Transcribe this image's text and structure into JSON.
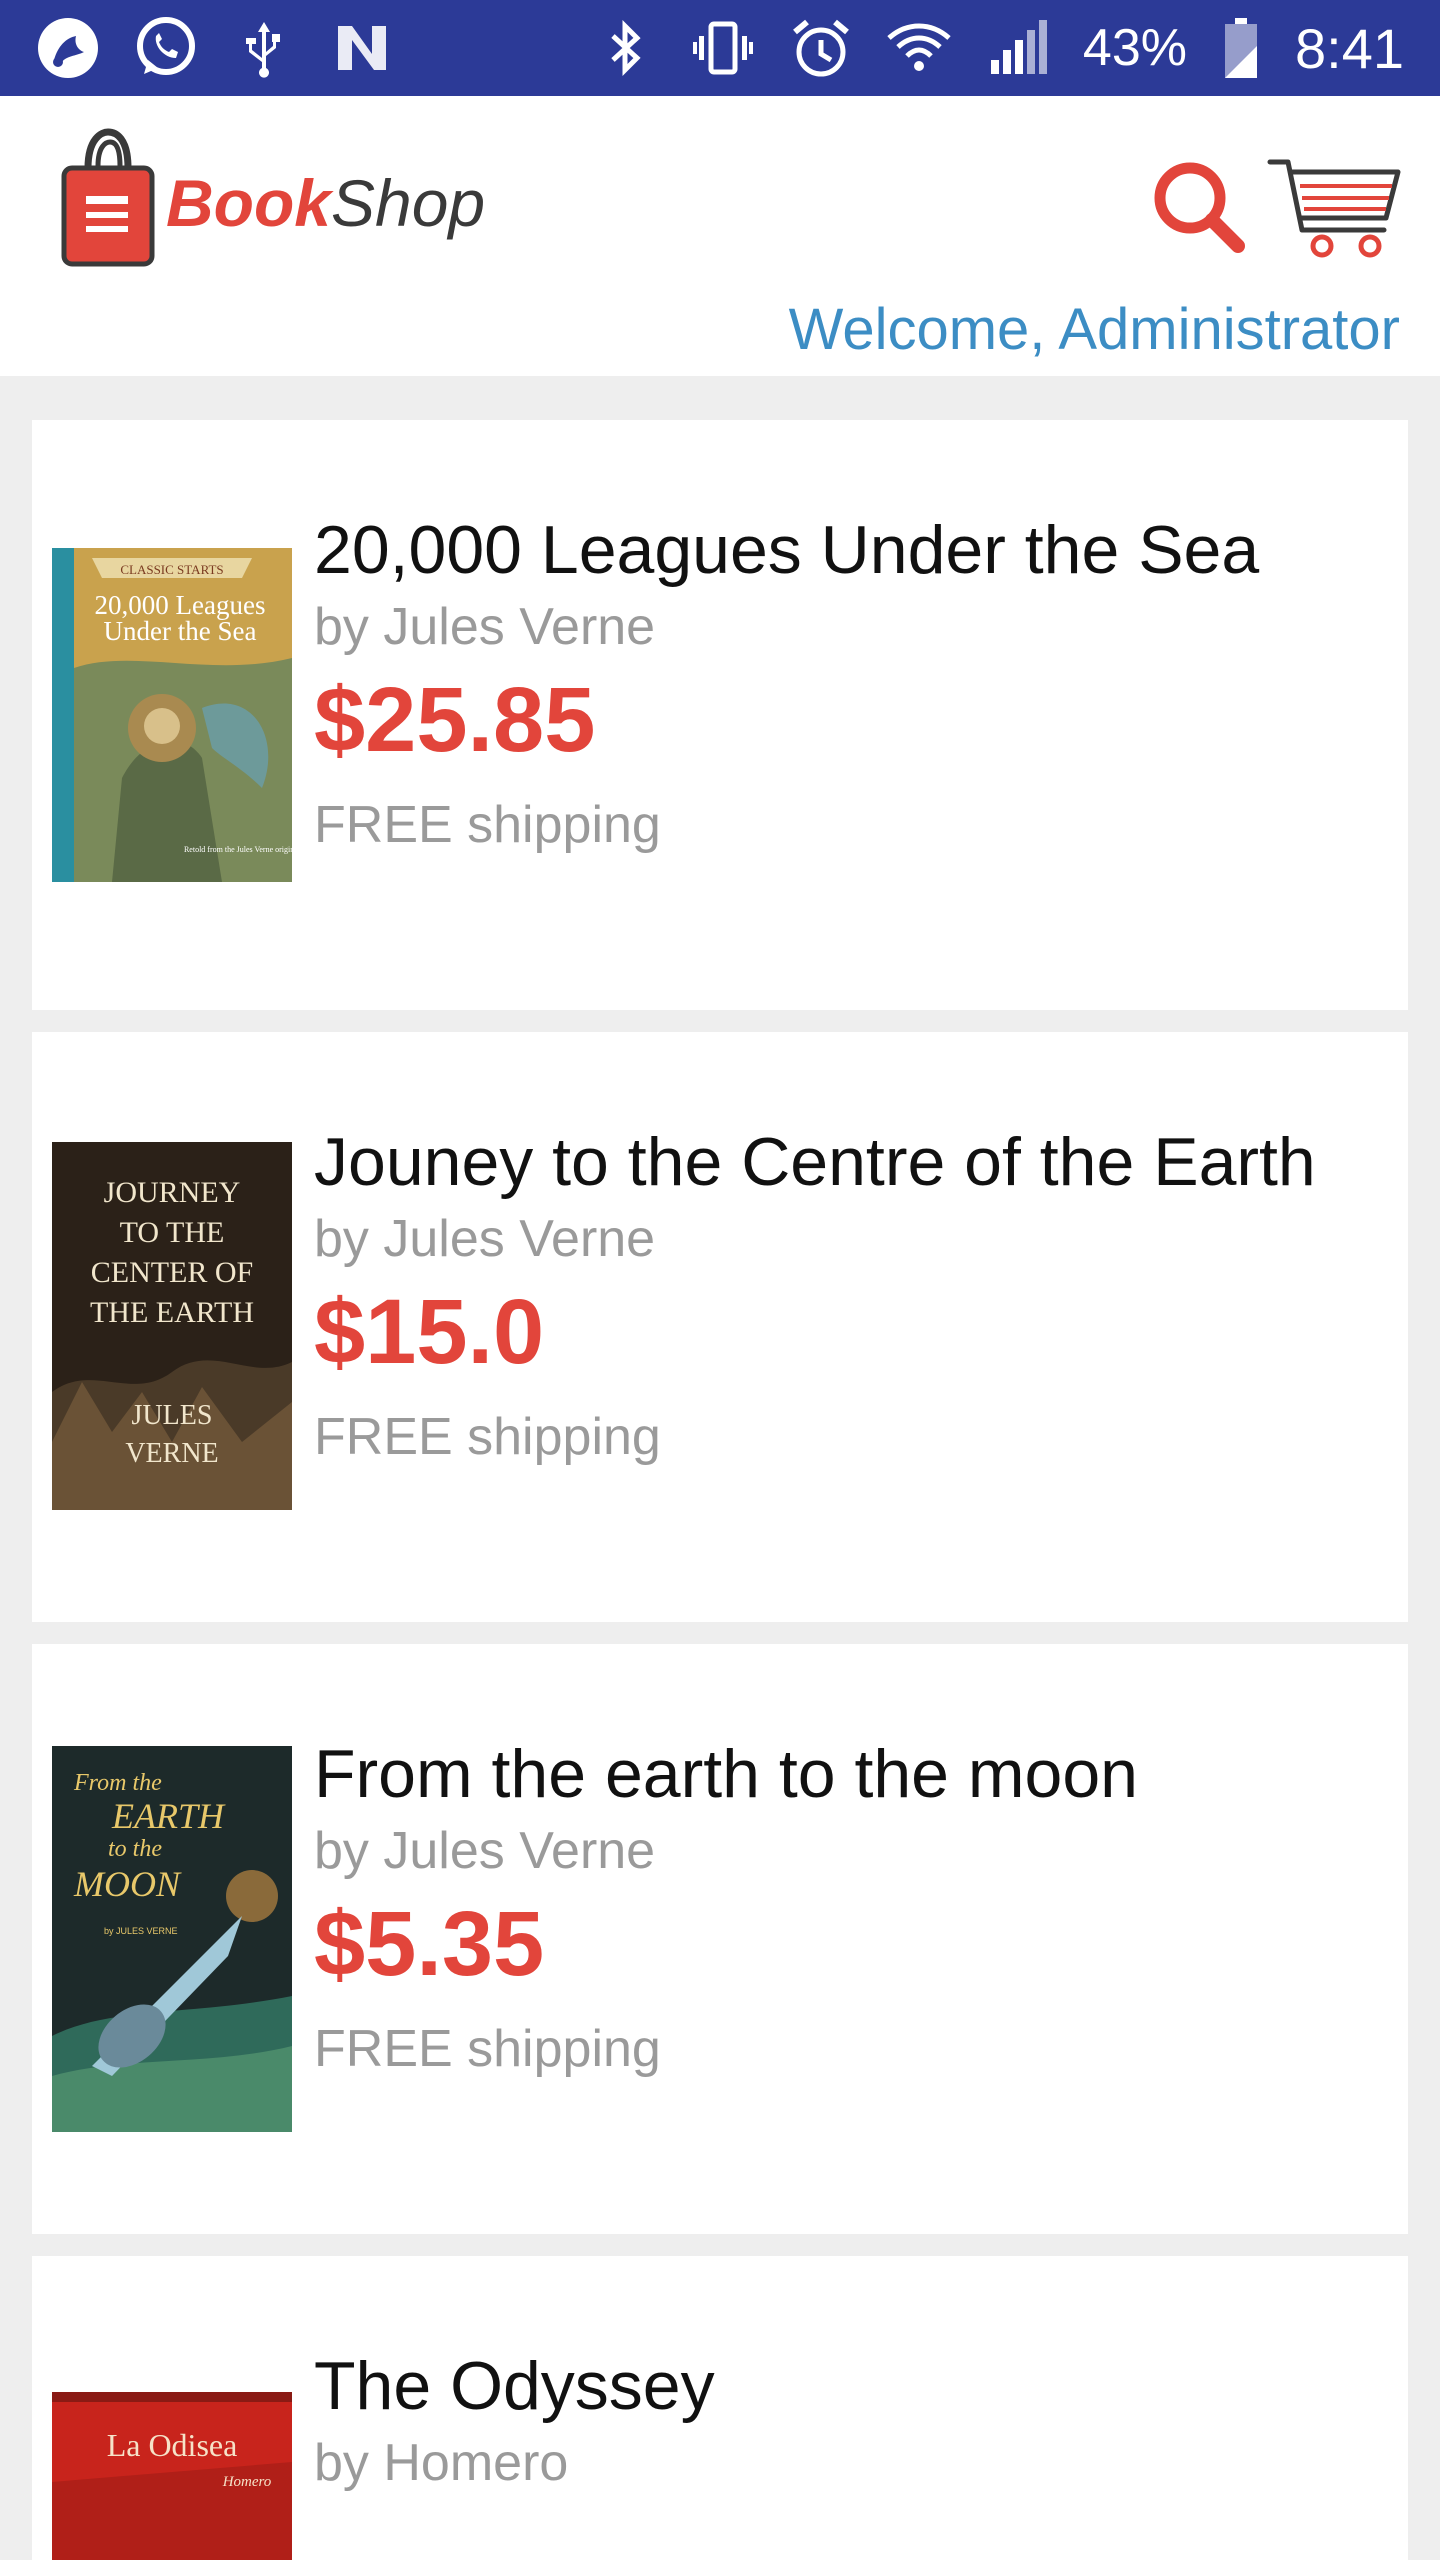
{
  "status_bar": {
    "battery": "43%",
    "time": "8:41",
    "left_icons": [
      "app-notification-icon",
      "whatsapp-icon",
      "usb-icon",
      "n-icon"
    ],
    "right_icons": [
      "bluetooth-icon",
      "vibrate-icon",
      "alarm-icon",
      "wifi-icon",
      "signal-icon",
      "battery-icon"
    ]
  },
  "header": {
    "logo_book": "Book",
    "logo_shop": "Shop",
    "welcome": "Welcome, Administrator"
  },
  "colors": {
    "status_bar": "#2c3a97",
    "accent": "#e2453b",
    "welcome": "#3c8dc4",
    "background": "#eeeeee"
  },
  "books": [
    {
      "title": "20,000 Leagues Under the Sea",
      "author": "by Jules Verne",
      "price": "$25.85",
      "shipping": "FREE shipping",
      "cover": {
        "line1": "CLASSIC STARTS",
        "line2": "20,000 Leagues",
        "line3": "Under the Sea",
        "footer": "Retold from the Jules Verne original"
      }
    },
    {
      "title": "Jouney to the Centre of the Earth",
      "author": "by Jules Verne",
      "price": "$15.0",
      "shipping": "FREE shipping",
      "cover": {
        "line1": "JOURNEY",
        "line2": "TO THE",
        "line3": "CENTER OF",
        "line4": "THE EARTH",
        "line5": "JULES",
        "line6": "VERNE"
      }
    },
    {
      "title": "From the earth to the moon",
      "author": "by Jules Verne",
      "price": "$5.35",
      "shipping": "FREE shipping",
      "cover": {
        "line1": "From the",
        "line2": "EARTH",
        "line3": "to the",
        "line4": "MOON",
        "line5": "by JULES VERNE"
      }
    },
    {
      "title": "The Odyssey",
      "author": "by Homero",
      "cover": {
        "line1": "La Odisea",
        "line2": "Homero"
      }
    }
  ]
}
